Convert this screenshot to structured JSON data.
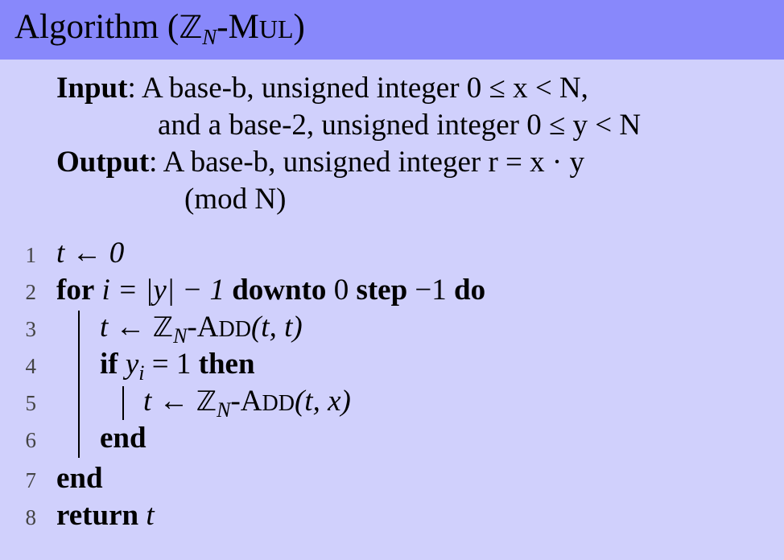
{
  "header": {
    "title_prefix": "Algorithm (",
    "title_set": "ℤ",
    "title_sub": "N",
    "title_dash": "-",
    "title_name_first": "M",
    "title_name_rest": "UL",
    "title_suffix": ")"
  },
  "spec": {
    "input_label": "Input",
    "input_line1": ": A base-b, unsigned integer 0 ≤ x < N,",
    "input_line2": "and a base-2, unsigned integer 0 ≤ y < N",
    "output_label": "Output",
    "output_line1": ": A base-b, unsigned integer r = x · y",
    "output_line2": "(mod N)"
  },
  "code": {
    "line_numbers": [
      "1",
      "2",
      "3",
      "4",
      "5",
      "6",
      "7",
      "8"
    ],
    "l1": "t ← 0",
    "l2_for": "for",
    "l2_mid": " i = |y| − 1 ",
    "l2_downto": "downto",
    "l2_zero": " 0 ",
    "l2_step": "step",
    "l2_neg": " −1 ",
    "l2_do": "do",
    "l3_lhs": "t ← ",
    "l3_set": "ℤ",
    "l3_sub": "N",
    "l3_dash": "-",
    "l3_name_first": "A",
    "l3_name_rest": "DD",
    "l3_args": "(t, t)",
    "l4_if": "if",
    "l4_cond_y": " y",
    "l4_cond_sub": "i",
    "l4_cond_rest": " = 1 ",
    "l4_then": "then",
    "l5_lhs": "t ← ",
    "l5_set": "ℤ",
    "l5_sub": "N",
    "l5_dash": "-",
    "l5_name_first": "A",
    "l5_name_rest": "DD",
    "l5_args": "(t, x)",
    "l6_end": "end",
    "l7_end": "end",
    "l8_return": "return",
    "l8_var": " t"
  }
}
